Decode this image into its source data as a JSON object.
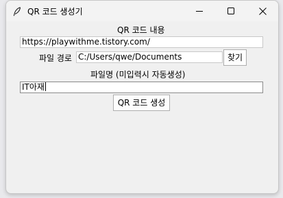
{
  "window": {
    "title": "QR 코드 생성기",
    "icon": "feather-icon",
    "controls": {
      "minimize_icon": "minimize-icon",
      "maximize_icon": "maximize-icon",
      "close_icon": "close-icon"
    }
  },
  "form": {
    "content_label": "QR 코드 내용",
    "content_value": "https://playwithme.tistory.com/",
    "path_label": "파일 경로",
    "path_value": "C:/Users/qwe/Documents",
    "browse_button": "찾기",
    "filename_label": "파일명 (미입력시 자동생성)",
    "filename_value": "IT아재",
    "generate_button": "QR 코드 생성"
  }
}
